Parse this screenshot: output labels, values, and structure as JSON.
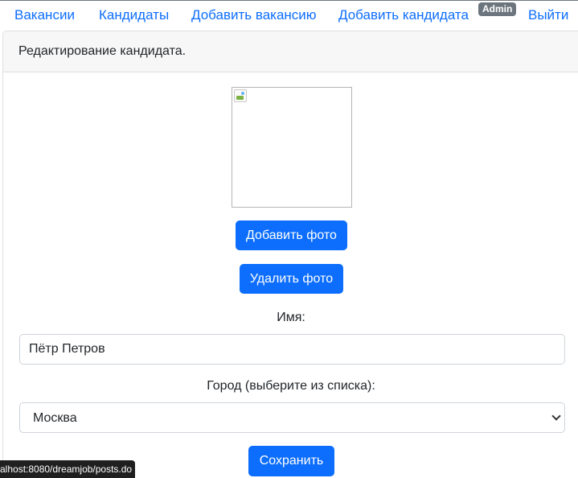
{
  "nav": {
    "vacancies": "Вакансии",
    "candidates": "Кандидаты",
    "add_vacancy": "Добавить вакансию",
    "add_candidate": "Добавить кандидата",
    "user_badge": "Admin",
    "logout": "Выйти"
  },
  "card": {
    "header": "Редактирование кандидата."
  },
  "photo": {
    "icon": "broken-image-icon",
    "add_button": "Добавить фото",
    "delete_button": "Удалить фото"
  },
  "form": {
    "name_label": "Имя:",
    "name_value": "Пётр Петров",
    "city_label": "Город (выберите из списка):",
    "city_selected": "Москва",
    "save_button": "Сохранить"
  },
  "statusbar": {
    "url": "alhost:8080/dreamjob/posts.do"
  },
  "colors": {
    "link": "#0d6efd",
    "primary_button": "#0d6efd",
    "badge": "#6c757d",
    "statusbar": "#1f1f1f"
  }
}
